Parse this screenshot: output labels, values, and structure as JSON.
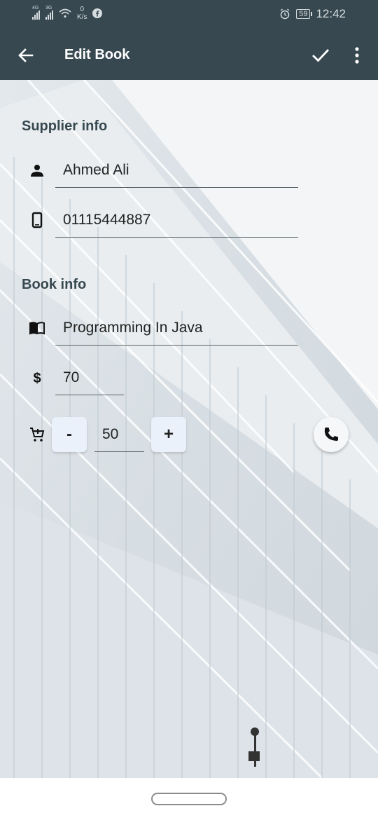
{
  "status_bar": {
    "net1": "4G",
    "net2": "3G",
    "data_speed_value": "0",
    "data_speed_unit": "K/s",
    "battery": "59",
    "time": "12:42"
  },
  "app_bar": {
    "title": "Edit Book"
  },
  "supplier": {
    "section_title": "Supplier info",
    "name": "Ahmed Ali",
    "phone": "01115444887"
  },
  "book": {
    "section_title": "Book info",
    "title": "Programming In Java",
    "price": "70",
    "quantity": "50",
    "minus_label": "-",
    "plus_label": "+"
  },
  "icons": {
    "back": "arrow-back-icon",
    "save": "check-icon",
    "more": "more-vert-icon",
    "person": "person-icon",
    "phone": "smartphone-icon",
    "book": "book-icon",
    "price": "dollar-icon",
    "cart": "add-shopping-cart-icon",
    "call": "phone-call-icon"
  },
  "colors": {
    "app_bar": "#374850",
    "section_title": "#374850",
    "qty_button": "#eaf1fb"
  }
}
